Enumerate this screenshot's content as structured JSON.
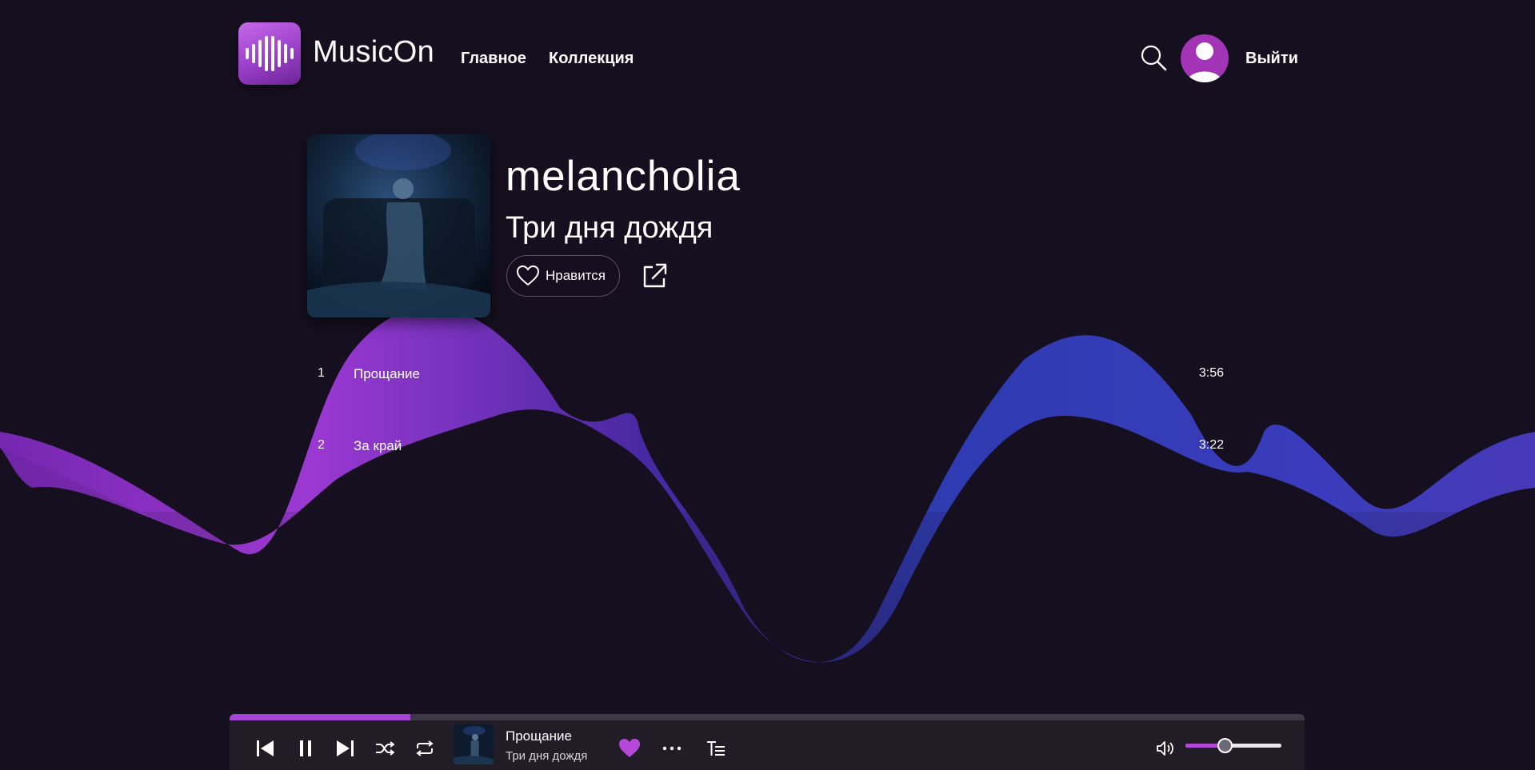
{
  "header": {
    "logo_text": "MusicOn",
    "nav": {
      "home": "Главное",
      "collection": "Коллекция"
    },
    "logout": "Выйти"
  },
  "album": {
    "title": "melancholia",
    "artist": "Три дня дождя",
    "like_label": "Нравится"
  },
  "tracks": [
    {
      "number": "1",
      "name": "Прощание",
      "duration": "3:56"
    },
    {
      "number": "2",
      "name": "За край",
      "duration": "3:22"
    }
  ],
  "player": {
    "now_playing_title": "Прощание",
    "now_playing_artist": "Три дня дождя",
    "progress_fraction": 0.168,
    "volume_fraction": 0.41,
    "liked": true,
    "controls": [
      "prev-icon",
      "pause-icon",
      "next-icon",
      "shuffle-icon",
      "repeat-icon"
    ]
  },
  "colors": {
    "background": "#160f1f",
    "accent": "#a545d8",
    "wave_purple": "#9b30d9",
    "wave_blue": "#3b3fc4",
    "player_bg": "#211d27",
    "avatar": "#a434b6"
  }
}
